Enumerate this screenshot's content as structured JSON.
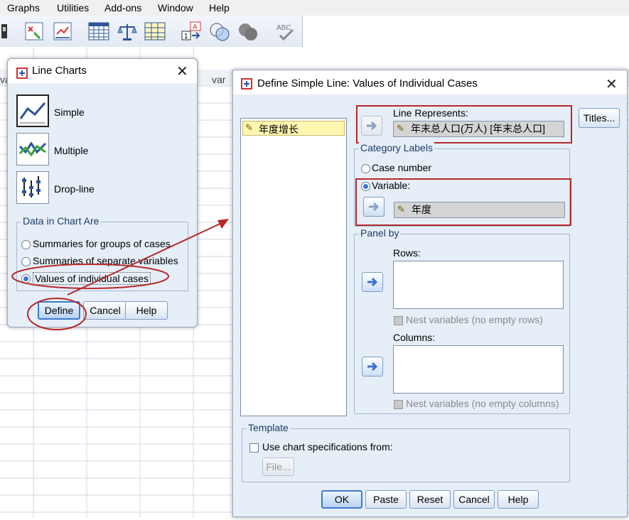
{
  "menubar": {
    "items": [
      "Graphs",
      "Utilities",
      "Add-ons",
      "Window",
      "Help"
    ]
  },
  "toolbar": {
    "icons": [
      "variable-icon",
      "select-cases-icon",
      "report-icon",
      "pivot-icon",
      "scale-icon",
      "grid-icon",
      "label-icon",
      "venn-icon",
      "sets-icon",
      "spell-check-icon"
    ]
  },
  "sheet": {
    "col_head_left": "va",
    "col_head_right": "var"
  },
  "line_charts": {
    "title": "Line Charts",
    "types": [
      {
        "label": "Simple",
        "icon": "simple-line-chart-icon"
      },
      {
        "label": "Multiple",
        "icon": "multiple-line-chart-icon"
      },
      {
        "label": "Drop-line",
        "icon": "drop-line-chart-icon"
      }
    ],
    "data_group_label": "Data in Chart Are",
    "options": [
      "Summaries for groups of cases",
      "Summaries of separate variables",
      "Values of individual cases"
    ],
    "selected_option": "Values of individual cases",
    "buttons": {
      "define": "Define",
      "cancel": "Cancel",
      "help": "Help"
    }
  },
  "define_dialog": {
    "title": "Define Simple Line: Values of Individual Cases",
    "variable_list": [
      "年度增长"
    ],
    "line_represents_label": "Line Represents:",
    "line_represents_value": "年末总人口(万人) [年末总人口]",
    "titles_button": "Titles...",
    "category_labels_group": "Category Labels",
    "case_number_label": "Case number",
    "variable_label": "Variable:",
    "variable_value": "年度",
    "panel_by_group": "Panel by",
    "rows_label": "Rows:",
    "nest_rows_label": "Nest variables (no empty rows)",
    "columns_label": "Columns:",
    "nest_columns_label": "Nest variables (no empty columns)",
    "template_group": "Template",
    "use_chart_spec_label": "Use chart specifications from:",
    "file_button": "File...",
    "buttons": {
      "ok": "OK",
      "paste": "Paste",
      "reset": "Reset",
      "cancel": "Cancel",
      "help": "Help"
    }
  },
  "colors": {
    "dialog_bg": "#e6eef8",
    "annotation_red": "#b52a2a",
    "accent_blue": "#3c79d1"
  }
}
